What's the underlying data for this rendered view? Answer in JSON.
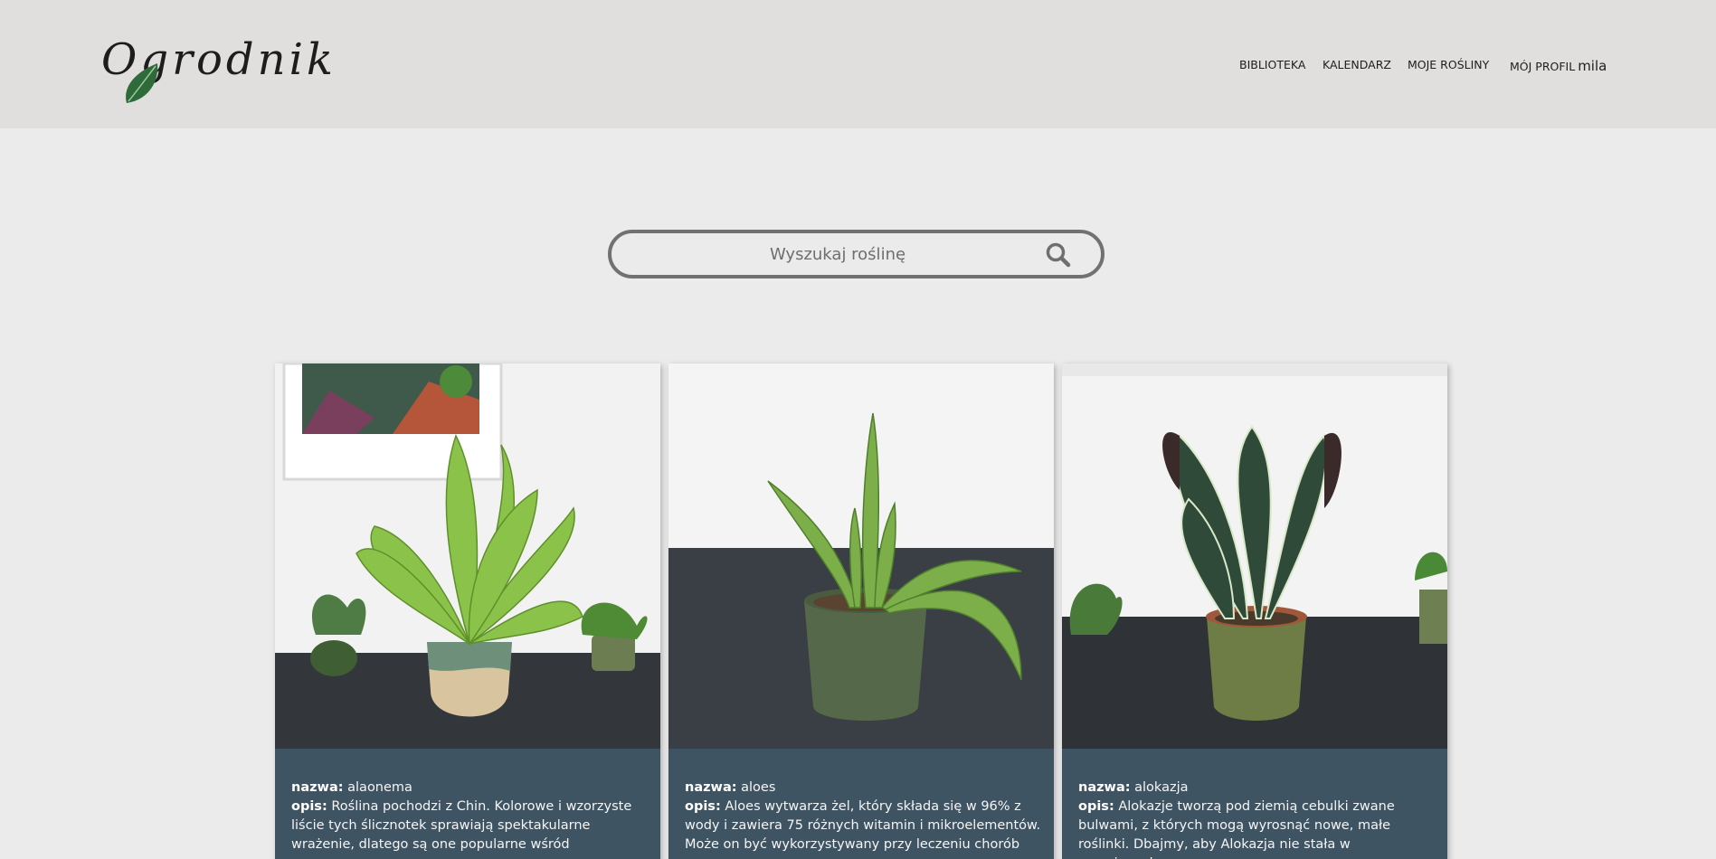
{
  "header": {
    "logo_text": "Ogrodnik",
    "nav": [
      {
        "label": "BIBLIOTEKA"
      },
      {
        "label": "KALENDARZ"
      },
      {
        "label": "MOJE ROŚLINY"
      },
      {
        "label": "MÓJ PROFIL"
      }
    ],
    "username": "mila"
  },
  "search": {
    "placeholder": "Wyszukaj roślinę",
    "icon": "search-icon"
  },
  "cards": [
    {
      "name_label": "nazwa:",
      "name": "alaonema",
      "desc_label": "opis:",
      "description": "Roślina pochodzi z Chin. Kolorowe i wzorzyste liście tych ślicznotek sprawiają spektakularne wrażenie, dlatego są one popularne wśród"
    },
    {
      "name_label": "nazwa:",
      "name": "aloes",
      "desc_label": "opis:",
      "description": "Aloes wytwarza żel, który składa się w 96% z wody i zawiera 75 różnych witamin i mikroelementów. Może on być wykorzystywany przy leczeniu chorób"
    },
    {
      "name_label": "nazwa:",
      "name": "alokazja",
      "desc_label": "opis:",
      "description": "Alokazje tworzą pod ziemią cebulki zwane bulwami, z których mogą wyrosnąć nowe, małe roślinki. Dbajmy, aby Alokazja nie stała w przeciągach,"
    }
  ],
  "colors": {
    "header_bg": "#e0dfdd",
    "page_bg": "#ebebeb",
    "card_info_bg": "#3e5463",
    "search_border": "#717171",
    "leaf_green": "#2f6b3a"
  }
}
